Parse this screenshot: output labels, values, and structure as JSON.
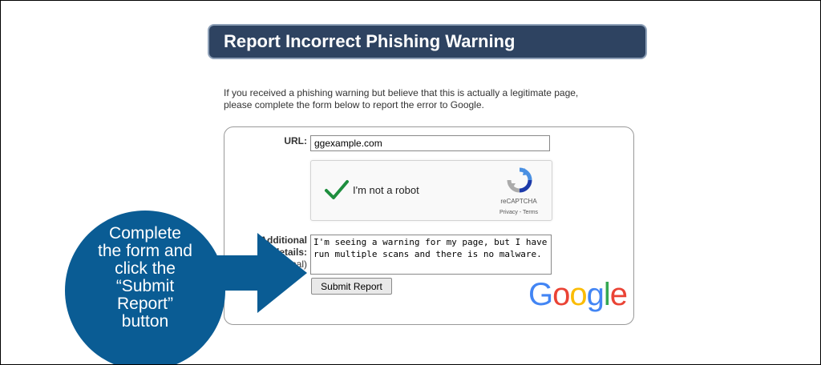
{
  "title": "Report Incorrect Phishing Warning",
  "intro": {
    "line1": "If you received a phishing warning but believe that this is actually a legitimate page,",
    "line2": "please complete the form below to report the error to Google."
  },
  "form": {
    "url_label": "URL:",
    "url_value": "ggexample.com",
    "captcha": {
      "label": "I'm not a robot",
      "brand": "reCAPTCHA",
      "links": "Privacy - Terms"
    },
    "details_label_bold1": "Additional",
    "details_label_bold2": "details:",
    "details_label_optional": "(Optional)",
    "details_value": "I'm seeing a warning for my page, but I have run multiple scans and there is no malware.",
    "submit_label": "Submit Report",
    "google_logo": "Google"
  },
  "callout": {
    "lines": [
      "Complete",
      "the form and",
      "click the",
      "“Submit",
      "Report”",
      "button"
    ],
    "color": "#0a5c94"
  },
  "colors": {
    "title_bg": "#2e4361",
    "check_green": "#1e8e3e",
    "google_blue": "#4285F4",
    "google_red": "#EA4335",
    "google_yellow": "#FBBC05",
    "google_green": "#34A853"
  }
}
